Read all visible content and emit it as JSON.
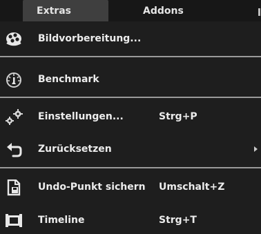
{
  "menubar": {
    "items": [
      {
        "label": "Extras"
      },
      {
        "label": "Addons"
      }
    ]
  },
  "menu": {
    "items": [
      {
        "label": "Bildvorbereitung...",
        "shortcut": "",
        "icon": "film-reel-icon"
      },
      {
        "label": "Benchmark",
        "shortcut": "",
        "icon": "speedometer-icon"
      },
      {
        "label": "Einstellungen...",
        "shortcut": "Strg+P",
        "icon": "gears-icon"
      },
      {
        "label": "Zurücksetzen",
        "shortcut": "",
        "icon": "undo-arrow-icon",
        "submenu": true
      },
      {
        "label": "Undo-Punkt sichern",
        "shortcut": "Umschalt+Z",
        "icon": "save-document-icon"
      },
      {
        "label": "Timeline",
        "shortcut": "Strg+T",
        "icon": "timeline-icon"
      }
    ]
  },
  "colors": {
    "background": "#1e1e1e",
    "menubar": "#171717",
    "active_menu": "#3f3f3f",
    "text": "#ececec",
    "separator": "#9a9a9a"
  }
}
